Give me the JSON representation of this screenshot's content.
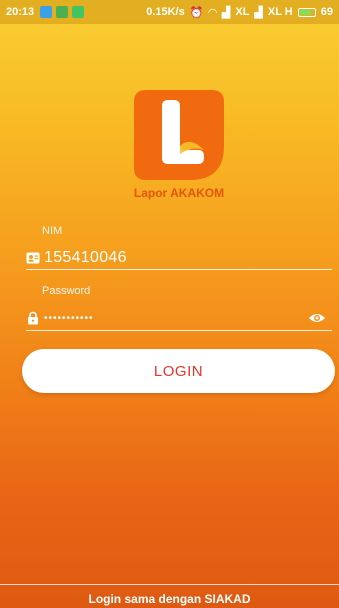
{
  "status_bar": {
    "time": "20:13",
    "network_speed": "0.15K/s",
    "carrier1": "XL",
    "carrier2": "XL H",
    "battery": "69"
  },
  "logo": {
    "text": "Lapor AKAKOM",
    "icon": "lapor-akakom-logo",
    "color": "#f26a10"
  },
  "form": {
    "nim_label": "NIM",
    "nim_value": "155410046",
    "password_label": "Password",
    "password_value": "•••••••••••",
    "login_label": "LOGIN"
  },
  "footer": {
    "text": "Login sama dengan SIAKAD"
  },
  "colors": {
    "accent": "#e8342a",
    "gradient_top": "#f9cf33",
    "gradient_bottom": "#de5a12"
  }
}
